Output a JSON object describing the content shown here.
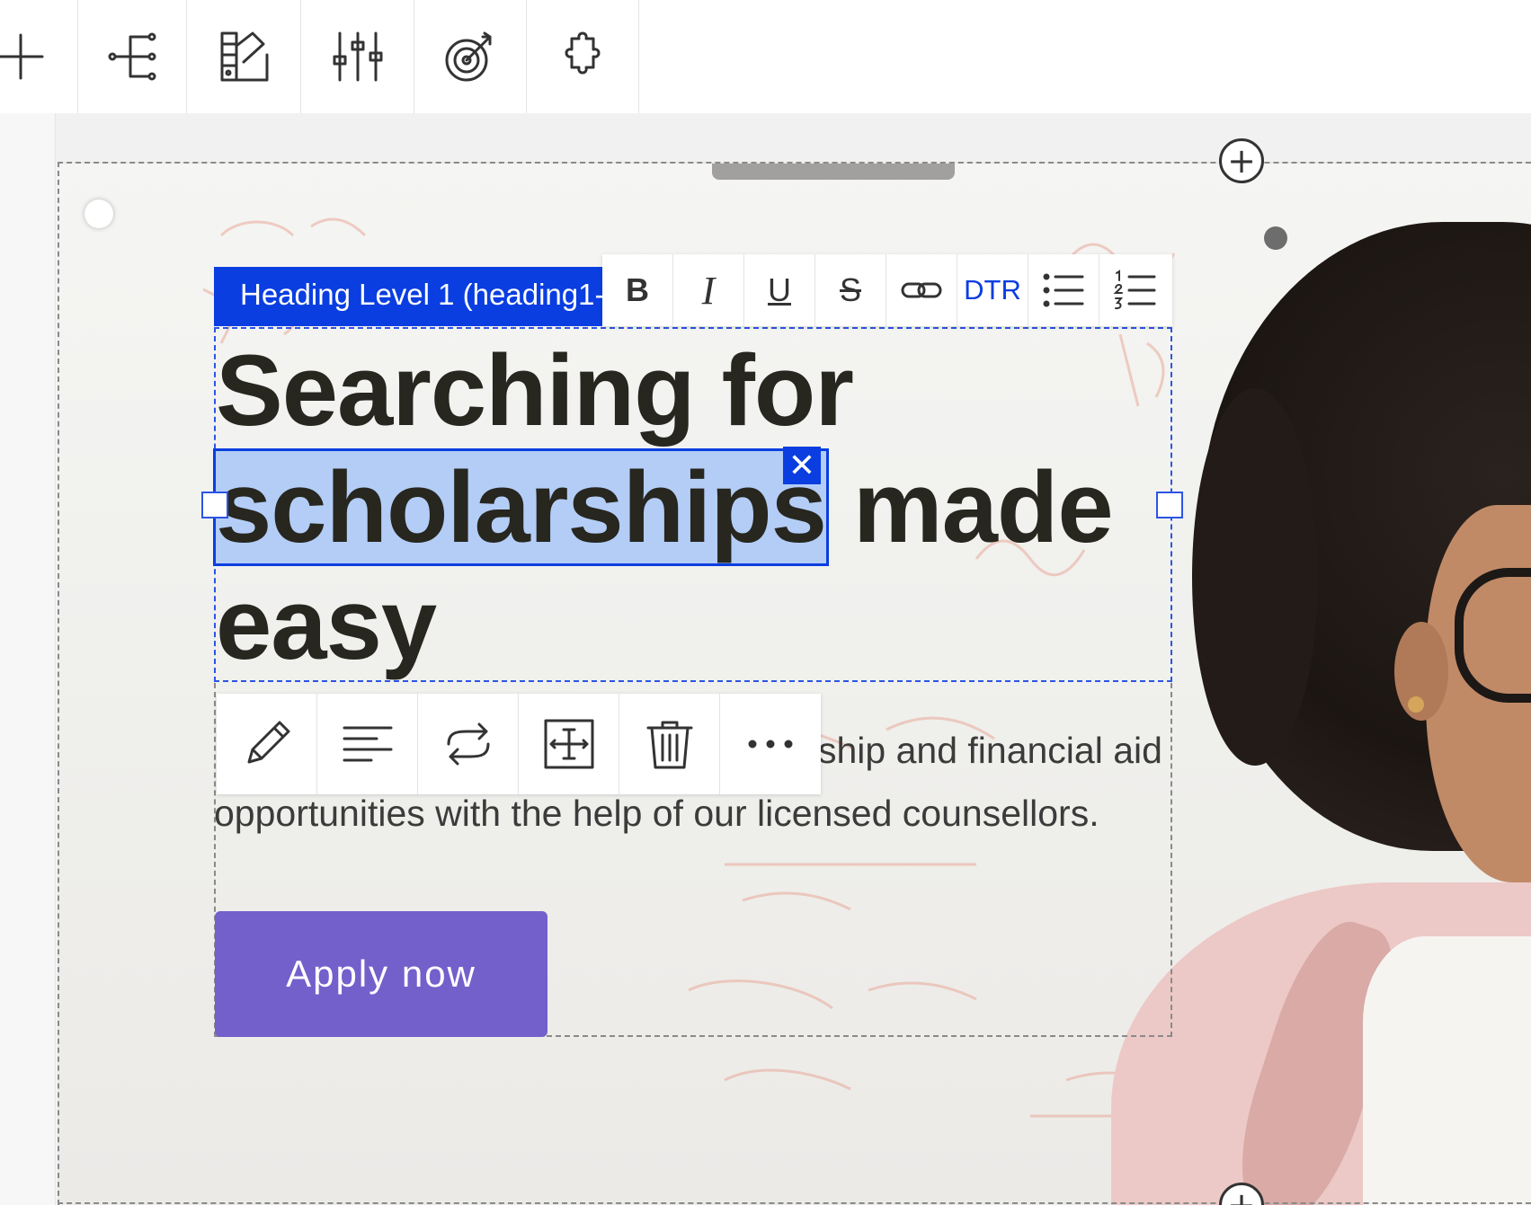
{
  "toolbar": {
    "tools": [
      {
        "name": "add-icon"
      },
      {
        "name": "navigator-tree-icon"
      },
      {
        "name": "theme-editor-icon"
      },
      {
        "name": "settings-sliders-icon"
      },
      {
        "name": "target-icon"
      },
      {
        "name": "plugin-puzzle-icon"
      }
    ]
  },
  "heading": {
    "element_label": "Heading Level 1 (heading1-s",
    "line1": "Searching for ",
    "selected_word": "scholarships",
    "line2_rest": " made",
    "line3": "easy"
  },
  "rich_text_toolbar": {
    "bold": "B",
    "italic": "I",
    "underline": "U",
    "strike": "S",
    "direction": "DTR"
  },
  "paragraph": {
    "line1_visible": "ship and financial aid",
    "line2": "opportunities with the help of our licensed counsellors."
  },
  "cta": {
    "label": "Apply now"
  },
  "colors": {
    "selection_blue": "#0a3ee0",
    "highlight": "#b3cdf6",
    "button_purple": "#7360cb",
    "heading_text": "#27261f"
  }
}
